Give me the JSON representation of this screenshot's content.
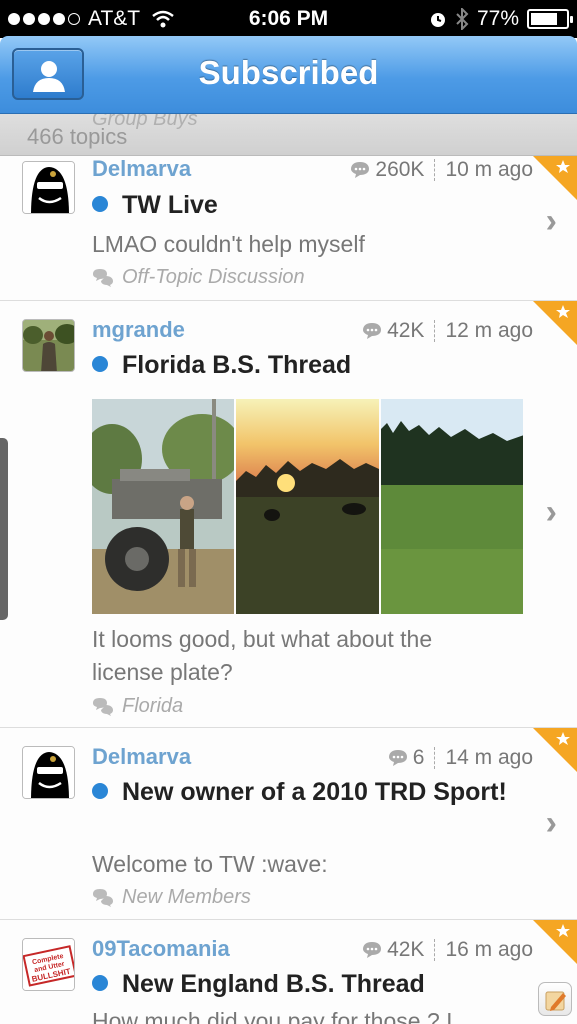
{
  "status": {
    "carrier": "AT&T",
    "time": "6:06 PM",
    "battery": "77%",
    "battery_level": 0.77
  },
  "nav": {
    "title": "Subscribed"
  },
  "subbar": {
    "ghost_forum": "Group Buys",
    "count": "466 topics"
  },
  "topics": [
    {
      "author": "Delmarva",
      "views": "260K",
      "time": "10 m ago",
      "title": "TW Live",
      "snippet": "LMAO couldn't help myself",
      "forum": "Off-Topic Discussion"
    },
    {
      "author": "mgrande",
      "views": "42K",
      "time": "12 m ago",
      "title": "Florida B.S. Thread",
      "snippet": "It looms good, but what about the license plate?",
      "forum": "Florida"
    },
    {
      "author": "Delmarva",
      "views": "6",
      "time": "14 m ago",
      "title": "New owner of a 2010 TRD Sport!",
      "snippet": "Welcome to TW :wave:",
      "forum": "New Members"
    },
    {
      "author": "09Tacomania",
      "views": "42K",
      "time": "16 m ago",
      "title": "New England B.S. Thread",
      "snippet": "How much did you pay for those ? I",
      "forum": ""
    }
  ],
  "avatar_badge": {
    "line1": "Complete",
    "line2": "and Utter",
    "line3": "BULLSHIT"
  },
  "colors": {
    "accent": "#2a86d6",
    "author": "#6ea3d0",
    "nav_top": "#93c9f7",
    "nav_bottom": "#3d8ddc",
    "star": "#f5a623"
  }
}
